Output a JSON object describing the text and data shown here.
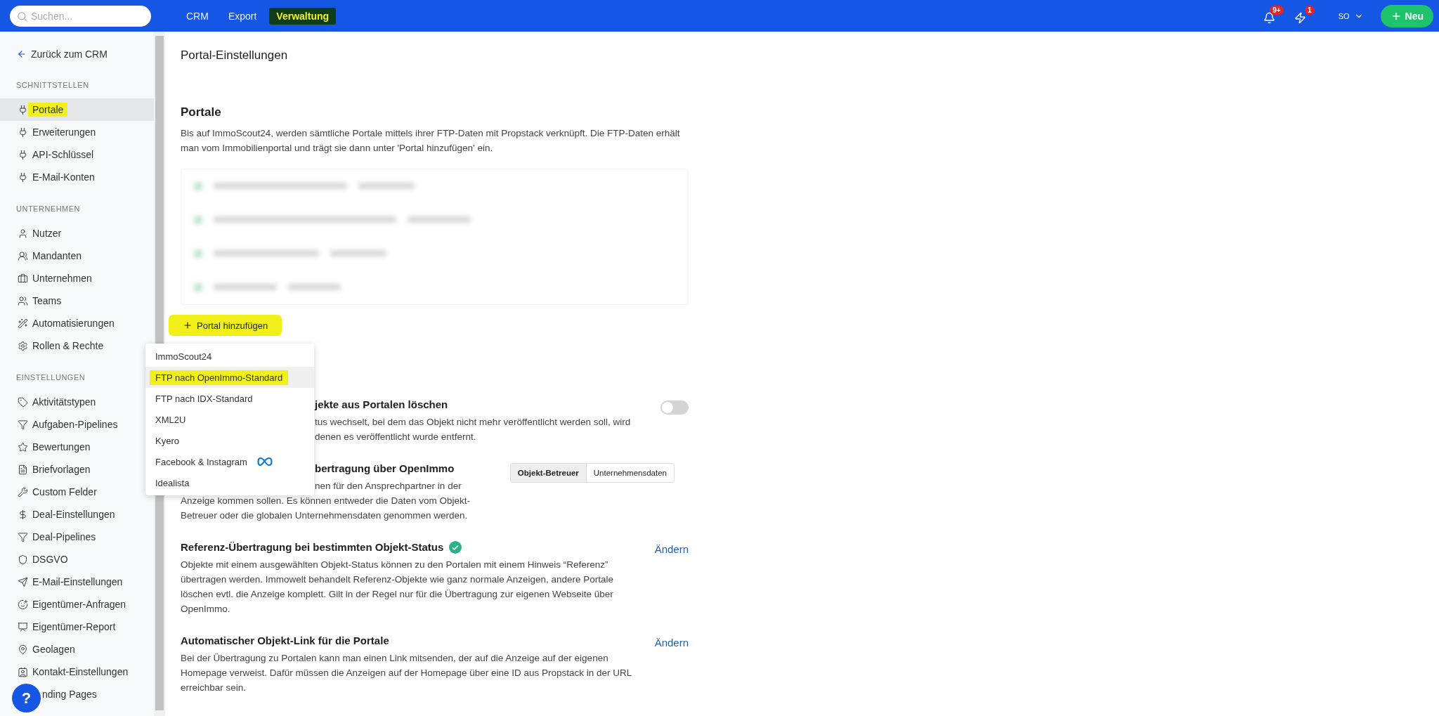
{
  "top_bar": {
    "search": {
      "placeholder": "Suchen..."
    },
    "nav": [
      {
        "label": "CRM",
        "selected": false,
        "highlighted": false
      },
      {
        "label": "Export",
        "selected": false,
        "highlighted": false
      },
      {
        "label": "Verwaltung",
        "selected": true,
        "highlighted": true
      }
    ],
    "notifications_badge": "9+",
    "activity_badge": "1",
    "user": "SO",
    "new_button": "Neu"
  },
  "sidebar": {
    "back_link": "Zurück zum CRM",
    "sections": [
      {
        "label": "SCHNITTSTELLEN",
        "items": [
          {
            "label": "Portale",
            "selected": true,
            "highlighted": true
          },
          {
            "label": "Erweiterungen",
            "selected": false,
            "highlighted": false
          },
          {
            "label": "API-Schlüssel",
            "selected": false,
            "highlighted": false
          },
          {
            "label": "E-Mail-Konten",
            "selected": false,
            "highlighted": false
          }
        ]
      },
      {
        "label": "UNTERNEHMEN",
        "items": [
          {
            "label": "Nutzer",
            "selected": false,
            "highlighted": false
          },
          {
            "label": "Mandanten",
            "selected": false,
            "highlighted": false
          },
          {
            "label": "Unternehmen",
            "selected": false,
            "highlighted": false
          },
          {
            "label": "Teams",
            "selected": false,
            "highlighted": false
          },
          {
            "label": "Automatisierungen",
            "selected": false,
            "highlighted": false
          },
          {
            "label": "Rollen & Rechte",
            "selected": false,
            "highlighted": false
          }
        ]
      },
      {
        "label": "EINSTELLUNGEN",
        "items": [
          {
            "label": "Aktivitätstypen",
            "selected": false,
            "highlighted": false
          },
          {
            "label": "Aufgaben-Pipelines",
            "selected": false,
            "highlighted": false
          },
          {
            "label": "Bewertungen",
            "selected": false,
            "highlighted": false
          },
          {
            "label": "Briefvorlagen",
            "selected": false,
            "highlighted": false
          },
          {
            "label": "Custom Felder",
            "selected": false,
            "highlighted": false
          },
          {
            "label": "Deal-Einstellungen",
            "selected": false,
            "highlighted": false
          },
          {
            "label": "Deal-Pipelines",
            "selected": false,
            "highlighted": false
          },
          {
            "label": "DSGVO",
            "selected": false,
            "highlighted": false
          },
          {
            "label": "E-Mail-Einstellungen",
            "selected": false,
            "highlighted": false
          },
          {
            "label": "Eigentümer-Anfragen",
            "selected": false,
            "highlighted": false
          },
          {
            "label": "Eigentümer-Report",
            "selected": false,
            "highlighted": false
          },
          {
            "label": "Geolagen",
            "selected": false,
            "highlighted": false
          },
          {
            "label": "Kontakt-Einstellungen",
            "selected": false,
            "highlighted": false
          },
          {
            "label": "nding Pages",
            "selected": false,
            "highlighted": false
          }
        ]
      }
    ],
    "help_button": "?"
  },
  "page": {
    "title": "Portal-Einstellungen",
    "portals": {
      "heading": "Portale",
      "description": "Bis auf ImmoScout24, werden sämtliche Portale mittels ihrer FTP-Daten mit Propstack verknüpft. Die FTP-Daten erhält man vom Immobilienportal und trägt sie dann unter 'Portal hinzufügen' ein.",
      "rows": [
        {
          "kind": "blurred"
        },
        {
          "kind": "blurred"
        },
        {
          "kind": "blurred"
        },
        {
          "kind": "blurred"
        }
      ],
      "add_button": {
        "label": "Portal hinzufügen",
        "highlighted": true
      },
      "menu": [
        {
          "label": "ImmoScout24",
          "selected": false,
          "highlighted": false
        },
        {
          "label": "FTP nach OpenImmo-Standard",
          "selected": true,
          "highlighted": true
        },
        {
          "label": "FTP nach IDX-Standard",
          "selected": false,
          "highlighted": false
        },
        {
          "label": "XML2U",
          "selected": false,
          "highlighted": false
        },
        {
          "label": "Kyero",
          "selected": false,
          "highlighted": false
        },
        {
          "label": "Facebook & Instagram",
          "selected": false,
          "highlighted": false,
          "logo": true
        },
        {
          "label": "Idealista",
          "selected": false,
          "highlighted": false
        }
      ]
    },
    "settings": [
      {
        "kind": "toggle",
        "title": "jekte aus Portalen löschen",
        "clipped": true,
        "fragments": [
          "tus wechselt, bei dem das Objekt nicht mehr veröffentlicht werden soll, wird",
          "denen es veröffentlicht wurde entfernt."
        ],
        "on": false
      },
      {
        "kind": "segmented",
        "title": "bertragung über OpenImmo",
        "clipped": true,
        "fragments": [
          "nen für den Ansprechpartner in der"
        ],
        "text": "Anzeige kommen sollen. Es können entweder die Daten vom Objekt-Betreuer oder die globalen Unternehmensdaten genommen werden.",
        "segments": [
          {
            "label": "Objekt-Betreuer",
            "selected": true
          },
          {
            "label": "Unternehmensdaten",
            "selected": false
          }
        ]
      },
      {
        "kind": "link",
        "title": "Referenz-Übertragung bei bestimmten Objekt-Status",
        "verified": true,
        "text": "Objekte mit einem ausgewählten Objekt-Status können zu den Portalen mit einem Hinweis “Referenz” übertragen werden. Immowelt behandelt Referenz-Objekte wie ganz normale Anzeigen, andere Portale löschen evtl. die Anzeige komplett. Gilt in der Regel nur für die Übertragung zur eigenen Webseite über OpenImmo.",
        "link": "Ändern"
      },
      {
        "kind": "link",
        "title": "Automatischer Objekt-Link für die Portale",
        "text": "Bei der Übertragung zu Portalen kann man einen Link mitsenden, der auf die Anzeige auf der eigenen Homepage verweist. Dafür müssen die Anzeigen auf der Homepage über eine ID aus Propstack in der URL erreichbar sein.",
        "link": "Ändern"
      }
    ]
  }
}
